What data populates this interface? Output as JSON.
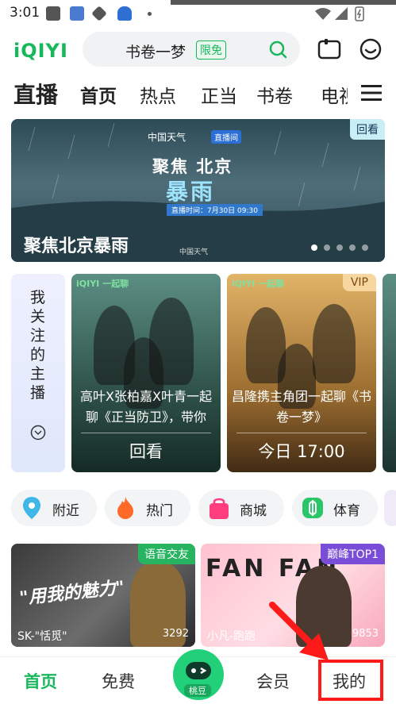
{
  "status_bar": {
    "time": "3:01"
  },
  "header": {
    "logo": "iQIYI",
    "search": {
      "text": "书卷一梦",
      "badge": "限免"
    }
  },
  "tabs": [
    "直播",
    "首页",
    "热点",
    "正当",
    "书卷",
    "电视"
  ],
  "banner": {
    "tag": "回看",
    "brand": "中国天气",
    "live_label": "直播间",
    "headline": "聚焦 北京",
    "big_title": "暴雨",
    "date_label": "直播时间：7月30日 09:30",
    "title": "聚焦北京暴雨",
    "source": "中国天气"
  },
  "follow_card": {
    "label": "我关注的主播"
  },
  "cards": [
    {
      "brand": "iQIYI 一起聊",
      "text": "高叶X张柏嘉X叶青一起聊《正当防卫》，带你",
      "footer": "回看",
      "vip": ""
    },
    {
      "brand": "iQIYI 一起聊",
      "text": "昌隆携主角团一起聊《书卷一梦》",
      "footer": "今日 17:00",
      "vip": "VIP"
    }
  ],
  "categories": [
    {
      "label": "附近",
      "icon": "location-icon",
      "color": "#3fb6e8"
    },
    {
      "label": "热门",
      "icon": "fire-icon",
      "color": "#ff6a2b"
    },
    {
      "label": "商城",
      "icon": "shopping-bag-icon",
      "color": "#ff3d7f"
    },
    {
      "label": "体育",
      "icon": "sports-icon",
      "color": "#2bc66a"
    }
  ],
  "videos": [
    {
      "tag": "语音交友",
      "name": "SK-\"恬觅\"",
      "count": "3292",
      "overlay": "\"用我的魅力\"",
      "tag_color": "#27b35f"
    },
    {
      "tag": "巅峰TOP1",
      "name": "小凡-跑跑",
      "count": "9853",
      "overlay": "FAN FAN",
      "tag_color": "#7a4dd8"
    }
  ],
  "bottom_nav": [
    "首页",
    "免费",
    "桃豆",
    "会员",
    "我的"
  ],
  "colors": {
    "accent": "#18b75c",
    "highlight": "#ff1a1a"
  }
}
